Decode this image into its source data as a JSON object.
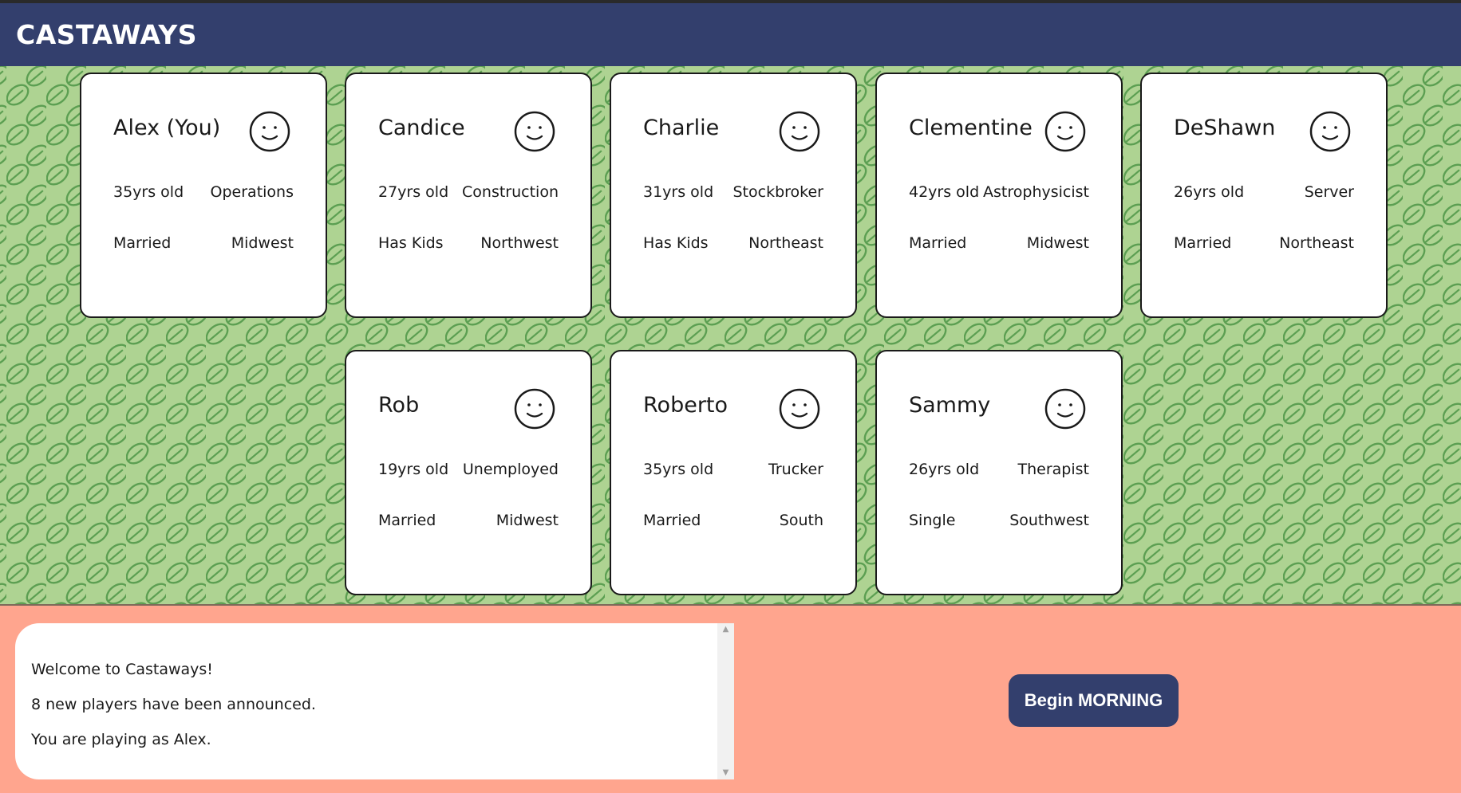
{
  "header": {
    "title": "CASTAWAYS"
  },
  "players": [
    {
      "name": "Alex (You)",
      "age": "35yrs old",
      "job": "Operations",
      "status": "Married",
      "region": "Midwest"
    },
    {
      "name": "Candice",
      "age": "27yrs old",
      "job": "Construction",
      "status": "Has Kids",
      "region": "Northwest"
    },
    {
      "name": "Charlie",
      "age": "31yrs old",
      "job": "Stockbroker",
      "status": "Has Kids",
      "region": "Northeast"
    },
    {
      "name": "Clementine",
      "age": "42yrs old",
      "job": "Astrophysicist",
      "status": "Married",
      "region": "Midwest"
    },
    {
      "name": "DeShawn",
      "age": "26yrs old",
      "job": "Server",
      "status": "Married",
      "region": "Northeast"
    },
    {
      "name": "Rob",
      "age": "19yrs old",
      "job": "Unemployed",
      "status": "Married",
      "region": "Midwest"
    },
    {
      "name": "Roberto",
      "age": "35yrs old",
      "job": "Trucker",
      "status": "Married",
      "region": "South"
    },
    {
      "name": "Sammy",
      "age": "26yrs old",
      "job": "Therapist",
      "status": "Single",
      "region": "Southwest"
    }
  ],
  "log": {
    "lines": [
      "Welcome to Castaways!",
      "8 new players have been announced.",
      "You are playing as Alex."
    ]
  },
  "actions": {
    "begin_label": "Begin MORNING"
  },
  "colors": {
    "header_bg": "#333f6d",
    "board_bg": "#aed392",
    "leaf_stroke": "#5c9f52",
    "bottom_bg": "#ffa58e",
    "button_bg": "#333f6d"
  },
  "icons": {
    "player_mood": "smiley-face-icon",
    "board_pattern": "leaf-icon"
  }
}
